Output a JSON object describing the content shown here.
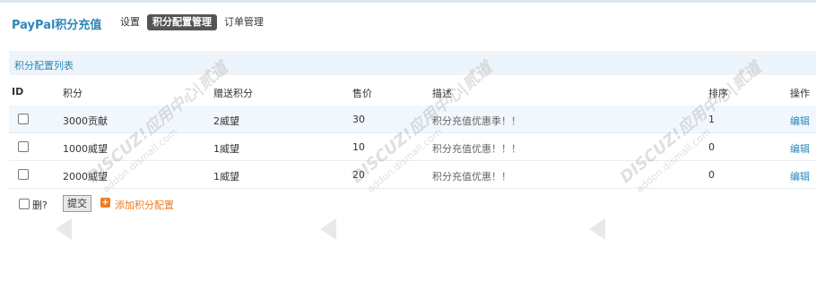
{
  "header": {
    "brand": "PayPal积分充值",
    "tabs": [
      {
        "label": "设置"
      },
      {
        "label": "积分配置管理"
      },
      {
        "label": "订单管理"
      }
    ]
  },
  "section": {
    "title": "积分配置列表"
  },
  "table": {
    "columns": [
      "ID",
      "积分",
      "赠送积分",
      "售价",
      "描述",
      "排序",
      "操作"
    ],
    "rows": [
      {
        "points": "3000贡献",
        "bonus": "2威望",
        "price": "30",
        "desc": "积分充值优惠季！！",
        "order": "1",
        "action": "编辑"
      },
      {
        "points": "1000威望",
        "bonus": "1威望",
        "price": "10",
        "desc": "积分充值优惠！！！",
        "order": "0",
        "action": "编辑"
      },
      {
        "points": "2000威望",
        "bonus": "1威望",
        "price": "20",
        "desc": "积分充值优惠！！",
        "order": "0",
        "action": "编辑"
      }
    ]
  },
  "footer": {
    "delete_label": "删?",
    "submit_label": "提交",
    "add_label": "添加积分配置",
    "add_icon": "+"
  },
  "watermark": {
    "text": "DISCUZ!应用中心|贰道",
    "sub": "addon.dismall.com"
  }
}
